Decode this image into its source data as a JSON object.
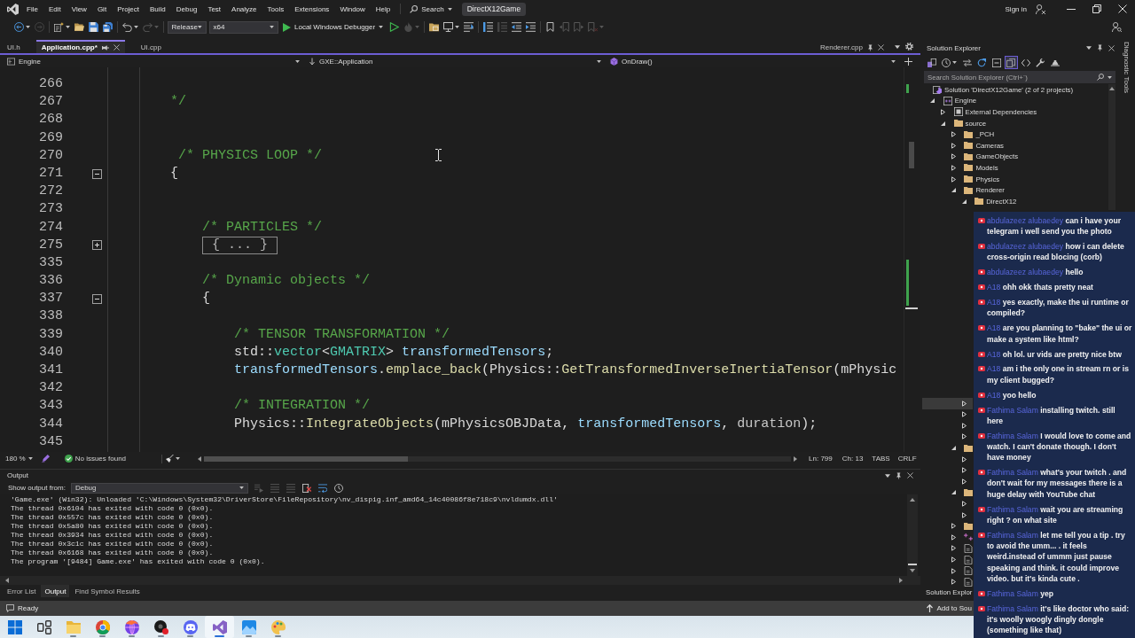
{
  "window": {
    "title": "DirectX12Game",
    "sign_in": "Sign in"
  },
  "menu": [
    "File",
    "Edit",
    "View",
    "Git",
    "Project",
    "Build",
    "Debug",
    "Test",
    "Analyze",
    "Tools",
    "Extensions",
    "Window",
    "Help"
  ],
  "search": {
    "label": "Search"
  },
  "toolbar": [
    {
      "kind": "back",
      "disabled": false
    },
    {
      "kind": "forward",
      "disabled": true
    },
    {
      "kind": "new-item",
      "disabled": false
    },
    {
      "kind": "open",
      "disabled": false
    },
    {
      "kind": "save",
      "disabled": false
    },
    {
      "kind": "save-all",
      "disabled": false
    },
    {
      "kind": "undo",
      "disabled": false
    },
    {
      "kind": "redo",
      "disabled": true
    },
    {
      "kind": "configuration",
      "value": "Release"
    },
    {
      "kind": "platform",
      "value": "x64"
    },
    {
      "kind": "run",
      "label": "Local Windows Debugger"
    },
    {
      "kind": "start",
      "disabled": false
    },
    {
      "kind": "hot-reload",
      "disabled": true
    },
    {
      "kind": "browse",
      "disabled": false
    },
    {
      "kind": "screen",
      "disabled": false
    },
    {
      "kind": "format",
      "disabled": false
    },
    {
      "kind": "comment",
      "disabled": false
    },
    {
      "kind": "uncomment",
      "disabled": true
    },
    {
      "kind": "outdent",
      "disabled": false
    },
    {
      "kind": "indent",
      "disabled": false
    },
    {
      "kind": "bookmark",
      "disabled": false
    },
    {
      "kind": "bookmark-prev",
      "disabled": true
    },
    {
      "kind": "bookmark-next",
      "disabled": true
    },
    {
      "kind": "bookmark-clear",
      "disabled": true
    },
    {
      "kind": "account",
      "disabled": false
    }
  ],
  "document_tabs": [
    {
      "label": "UI.h",
      "selected": false
    },
    {
      "label": "Application.cpp*",
      "selected": true
    },
    {
      "label": "UI.cpp",
      "selected": false
    }
  ],
  "pinned_tabs": [
    {
      "label": "Renderer.cpp",
      "selected": false
    }
  ],
  "navigation_bar": {
    "project": "Engine",
    "scope": "GXE::Application",
    "member": "OnDraw()"
  },
  "editor": {
    "lines": [
      {
        "number": "266"
      },
      {
        "number": "267",
        "tokens": [
          {
            "text": "\t\t*/",
            "kind": "comment"
          }
        ]
      },
      {
        "number": "268"
      },
      {
        "number": "269"
      },
      {
        "number": "270",
        "tokens": [
          {
            "text": "\t\t /* PHYSICS LOOP */",
            "kind": "comment"
          }
        ]
      },
      {
        "number": "271",
        "expanded": true,
        "tokens": [
          {
            "text": "\t\t{",
            "kind": "plain"
          }
        ]
      },
      {
        "number": "272"
      },
      {
        "number": "273"
      },
      {
        "number": "274",
        "tokens": [
          {
            "text": "\t\t\t/* PARTICLES */",
            "kind": "comment"
          }
        ]
      },
      {
        "number": "275",
        "expanded": false,
        "tokens": [
          {
            "text": "\t\t\t{ ... }",
            "kind": "collapsed"
          }
        ]
      },
      {
        "number": "335"
      },
      {
        "number": "336",
        "tokens": [
          {
            "text": "\t\t\t/* Dynamic objects */",
            "kind": "comment"
          }
        ]
      },
      {
        "number": "337",
        "expanded": true,
        "tokens": [
          {
            "text": "\t\t\t{",
            "kind": "plain"
          }
        ]
      },
      {
        "number": "338"
      },
      {
        "number": "339",
        "tokens": [
          {
            "text": "\t\t\t\t/* TENSOR TRANSFORMATION */",
            "kind": "comment"
          }
        ]
      },
      {
        "number": "340",
        "tokens": [
          {
            "text": "\t\t\t\tstd::",
            "kind": "plain"
          },
          {
            "text": "vector",
            "kind": "type"
          },
          {
            "text": "<",
            "kind": "plain"
          },
          {
            "text": "GMATRIX",
            "kind": "type"
          },
          {
            "text": "> ",
            "kind": "plain"
          },
          {
            "text": "transformedTensors",
            "kind": "variable"
          },
          {
            "text": ";",
            "kind": "plain"
          }
        ]
      },
      {
        "number": "341",
        "tokens": [
          {
            "text": "\t\t\t\ttransformedTensors",
            "kind": "variable"
          },
          {
            "text": ".",
            "kind": "plain"
          },
          {
            "text": "emplace_back",
            "kind": "function"
          },
          {
            "text": "(Physics::",
            "kind": "plain"
          },
          {
            "text": "GetTransformedInverseInertiaTensor",
            "kind": "function"
          },
          {
            "text": "(",
            "kind": "plain"
          },
          {
            "text": "mPhysic",
            "kind": "member"
          }
        ]
      },
      {
        "number": "342"
      },
      {
        "number": "343",
        "tokens": [
          {
            "text": "\t\t\t\t/* INTEGRATION */",
            "kind": "comment"
          }
        ]
      },
      {
        "number": "344",
        "tokens": [
          {
            "text": "\t\t\t\tPhysics::",
            "kind": "plain"
          },
          {
            "text": "IntegrateObjects",
            "kind": "function"
          },
          {
            "text": "(",
            "kind": "plain"
          },
          {
            "text": "mPhysicsOBJData",
            "kind": "member"
          },
          {
            "text": ", ",
            "kind": "plain"
          },
          {
            "text": "transformedTensors",
            "kind": "variable"
          },
          {
            "text": ", ",
            "kind": "plain"
          },
          {
            "text": "duration",
            "kind": "parameter"
          },
          {
            "text": ");",
            "kind": "plain"
          }
        ]
      },
      {
        "number": "345"
      }
    ]
  },
  "editor_status": {
    "zoom": "180 %",
    "issues": "No issues found",
    "line": "Ln: 799",
    "column": "Ch: 13",
    "indentation": "TABS",
    "line_endings": "CRLF"
  },
  "output": {
    "title": "Output",
    "source_label": "Show output from:",
    "source": "Debug",
    "toolbar": [
      {
        "kind": "find",
        "disabled": true
      },
      {
        "kind": "previous",
        "disabled": true
      },
      {
        "kind": "next",
        "disabled": true
      },
      {
        "kind": "clear",
        "disabled": false
      },
      {
        "kind": "wrap",
        "disabled": false
      },
      {
        "kind": "timestamp",
        "disabled": false
      }
    ],
    "lines": [
      "'Game.exe' (Win32): Unloaded 'C:\\Windows\\System32\\DriverStore\\FileRepository\\nv_dispig.inf_amd64_14c40086f8e718c9\\nvldumdx.dll'",
      "The thread 0x6104 has exited with code 0 (0x0).",
      "The thread 0x557c has exited with code 0 (0x0).",
      "The thread 0x5a80 has exited with code 0 (0x0).",
      "The thread 0x3934 has exited with code 0 (0x0).",
      "The thread 0x3c1c has exited with code 0 (0x0).",
      "The thread 0x6168 has exited with code 0 (0x0).",
      "The program '[9484] Game.exe' has exited with code 0 (0x0)."
    ]
  },
  "output_tabs": [
    {
      "label": "Error List",
      "selected": false
    },
    {
      "label": "Output",
      "selected": true
    },
    {
      "label": "Find Symbol Results",
      "selected": false
    }
  ],
  "solution_explorer": {
    "title": "Solution Explorer",
    "toolbar": [
      {
        "kind": "switch-views",
        "selected": false
      },
      {
        "kind": "history",
        "selected": false
      },
      {
        "kind": "sync",
        "selected": false
      },
      {
        "kind": "refresh",
        "selected": false
      },
      {
        "kind": "collapse-all",
        "selected": false
      },
      {
        "kind": "show-all-files",
        "selected": true
      },
      {
        "kind": "code",
        "selected": false
      },
      {
        "kind": "properties",
        "selected": false
      },
      {
        "kind": "preview",
        "selected": false
      }
    ],
    "search": {
      "placeholder": "Search Solution Explorer (Ctrl+¨)"
    },
    "tree": {
      "label": "Solution 'DirectX12Game' (2 of 2 projects)",
      "kind": "solution",
      "selected": false,
      "children": [
        {
          "label": "Engine",
          "kind": "project",
          "expanded": true,
          "selected": false,
          "children": [
            {
              "label": "External Dependencies",
              "kind": "dependencies",
              "expanded": false,
              "selected": false
            },
            {
              "label": "source",
              "kind": "folder",
              "expanded": true,
              "selected": false,
              "children": [
                {
                  "label": "_PCH",
                  "kind": "folder",
                  "expanded": false,
                  "selected": false
                },
                {
                  "label": "Cameras",
                  "kind": "folder",
                  "expanded": false,
                  "selected": false
                },
                {
                  "label": "GameObjects",
                  "kind": "folder",
                  "expanded": false,
                  "selected": false
                },
                {
                  "label": "Models",
                  "kind": "folder",
                  "expanded": false,
                  "selected": false
                },
                {
                  "label": "Physics",
                  "kind": "folder",
                  "expanded": false,
                  "selected": false
                },
                {
                  "label": "Renderer",
                  "kind": "folder",
                  "expanded": true,
                  "selected": false,
                  "children": [
                    {
                      "label": "DirectX12",
                      "kind": "folder",
                      "expanded": true,
                      "selected": false
                    },
                    {
                      "expanded": false,
                      "selected": true
                    },
                    {
                      "expanded": false,
                      "selected": false
                    },
                    {
                      "expanded": false,
                      "selected": false
                    },
                    {
                      "expanded": false,
                      "selected": false
                    }
                  ]
                },
                {
                  "kind": "folder",
                  "expanded": true,
                  "selected": false,
                  "children": [
                    {
                      "expanded": false,
                      "selected": false
                    },
                    {
                      "expanded": false,
                      "selected": false
                    },
                    {
                      "expanded": false,
                      "selected": false
                    }
                  ]
                },
                {
                  "kind": "folder",
                  "expanded": true,
                  "selected": false,
                  "children": [
                    {
                      "expanded": false,
                      "selected": false
                    },
                    {
                      "expanded": false,
                      "selected": false
                    }
                  ]
                },
                {
                  "kind": "folder",
                  "expanded": false,
                  "selected": false
                },
                {
                  "kind": "cpp-file",
                  "expanded": false,
                  "selected": false
                },
                {
                  "kind": "file",
                  "expanded": false,
                  "selected": false
                },
                {
                  "kind": "file",
                  "expanded": false,
                  "selected": false
                },
                {
                  "kind": "file",
                  "expanded": false,
                  "selected": false
                },
                {
                  "kind": "file",
                  "expanded": false,
                  "selected": false
                }
              ]
            }
          ]
        }
      ]
    },
    "tab": "Solution Explor"
  },
  "side_tabs": [
    "Diagnostic Tools"
  ],
  "status_bar": {
    "text": "Ready",
    "action": "Add to Sou"
  },
  "taskbar": [
    {
      "kind": "start",
      "running": false,
      "selected": false
    },
    {
      "kind": "task-view",
      "running": false,
      "selected": false
    },
    {
      "kind": "files",
      "running": true,
      "selected": false
    },
    {
      "kind": "browser",
      "running": true,
      "selected": false
    },
    {
      "kind": "fox-browser",
      "running": true,
      "selected": false
    },
    {
      "kind": "recorder",
      "running": true,
      "selected": false
    },
    {
      "kind": "chat-app",
      "running": true,
      "selected": false
    },
    {
      "kind": "ide",
      "running": true,
      "selected": true
    },
    {
      "kind": "photos",
      "running": true,
      "selected": false
    },
    {
      "kind": "paint",
      "running": true,
      "selected": false
    }
  ],
  "chat": {
    "messages": [
      {
        "author": "abdulazeez alubaedey",
        "text": "can i have your telegram i well send you the photo"
      },
      {
        "author": "abdulazeez alubaedey",
        "text": "how i can delete cross-origin read blocing (corb)"
      },
      {
        "author": "abdulazeez alubaedey",
        "text": "hello"
      },
      {
        "author": "A18",
        "text": "ohh okk thats pretty neat"
      },
      {
        "author": "A18",
        "text": "yes exactly, make the ui runtime or compiled?"
      },
      {
        "author": "A18",
        "text": "are you planning to \"bake\" the ui or make a system like html?"
      },
      {
        "author": "A18",
        "text": "oh lol. ur vids are pretty nice btw"
      },
      {
        "author": "A18",
        "text": "am i the only one in stream rn or is my client bugged?"
      },
      {
        "author": "A18",
        "text": "yoo hello"
      },
      {
        "author": "Fathima Salam",
        "text": "installing twitch. still here"
      },
      {
        "author": "Fathima Salam",
        "text": "I would love to come and watch. I can't donate though. I don't have money"
      },
      {
        "author": "Fathima Salam",
        "text": "what's your twitch . and don't wait for my messages there is a huge delay with YouTube chat"
      },
      {
        "author": "Fathima Salam",
        "text": "wait you are streaming right ? on what site"
      },
      {
        "author": "Fathima Salam",
        "text": "let me tell you a tip . try to avoid the umm... . it feels weird.instead of ummm just pause speaking and think. it could improve video. but it's kinda cute ."
      },
      {
        "author": "Fathima Salam",
        "text": "yep"
      },
      {
        "author": "Fathima Salam",
        "text": "it's like doctor who said: it's woolly woogly dingly dongle (something like that)"
      }
    ]
  }
}
